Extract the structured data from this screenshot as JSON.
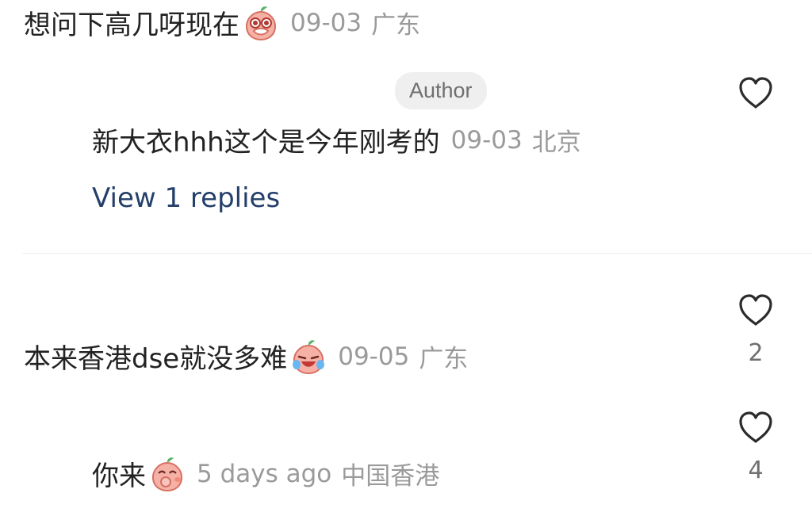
{
  "comments": [
    {
      "text": "想问下高几呀现在",
      "emoji": "peach-pleading-emoji",
      "date": "09-03",
      "location": "广东"
    },
    {
      "author_badge": "Author",
      "text": "新大衣hhh这个是今年刚考的",
      "date": "09-03",
      "location": "北京",
      "replies_link": "View 1 replies"
    },
    {
      "text": "本来香港dse就没多难",
      "emoji": "peach-laughing-crying-emoji",
      "date": "09-05",
      "location": "广东",
      "likes": "2"
    },
    {
      "text": "你来",
      "emoji": "peach-shy-emoji",
      "date": "5 days ago",
      "location": "中国香港",
      "likes": "4"
    }
  ],
  "icons": {
    "like": "heart-outline-icon"
  },
  "colors": {
    "text": "#222222",
    "meta": "#9a9a9a",
    "link": "#243f6a",
    "badge_bg": "#efefef"
  }
}
